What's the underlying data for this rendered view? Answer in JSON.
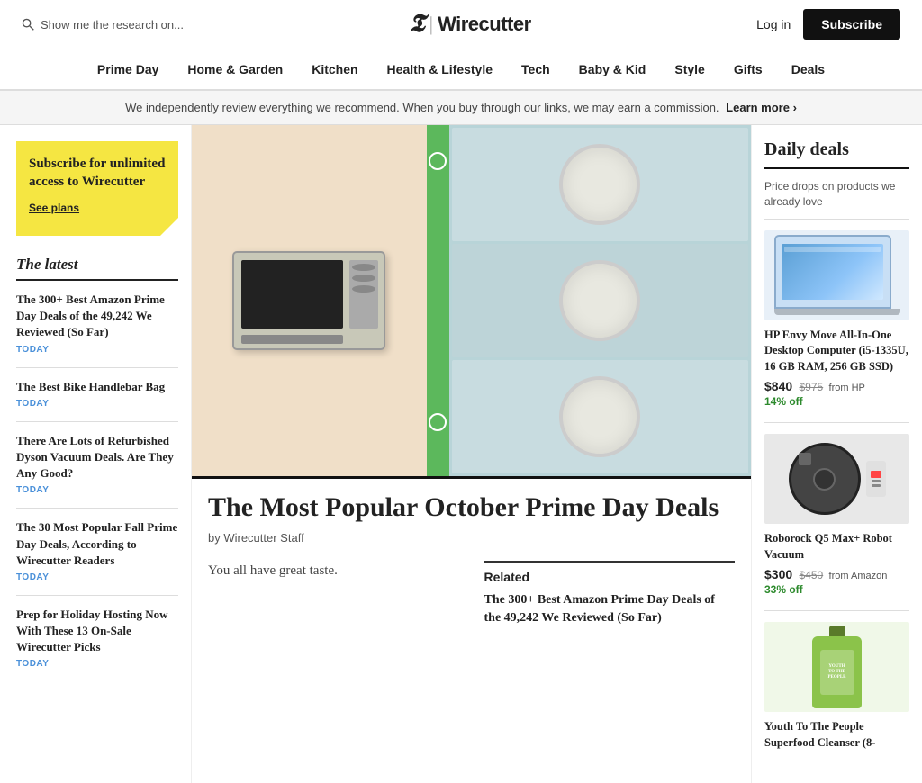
{
  "header": {
    "search_placeholder": "Show me the research on...",
    "logo_t": "T",
    "logo_divider": "|",
    "logo_name": "Wirecutter",
    "login_label": "Log in",
    "subscribe_label": "Subscribe"
  },
  "nav": {
    "items": [
      {
        "id": "prime-day",
        "label": "Prime Day"
      },
      {
        "id": "home-garden",
        "label": "Home & Garden"
      },
      {
        "id": "kitchen",
        "label": "Kitchen"
      },
      {
        "id": "health-lifestyle",
        "label": "Health & Lifestyle"
      },
      {
        "id": "tech",
        "label": "Tech"
      },
      {
        "id": "baby-kid",
        "label": "Baby & Kid"
      },
      {
        "id": "style",
        "label": "Style"
      },
      {
        "id": "gifts",
        "label": "Gifts"
      },
      {
        "id": "deals",
        "label": "Deals"
      }
    ]
  },
  "banner": {
    "text": "We independently review everything we recommend. When you buy through our links, we may earn a commission.",
    "link_text": "Learn more ›"
  },
  "sidebar_left": {
    "subscribe_box": {
      "title": "Subscribe for unlimited access to Wirecutter",
      "link": "See plans"
    },
    "latest_heading": "The latest",
    "items": [
      {
        "title": "The 300+ Best Amazon Prime Day Deals of the 49,242 We Reviewed (So Far)",
        "date": "TODAY"
      },
      {
        "title": "The Best Bike Handlebar Bag",
        "date": "TODAY"
      },
      {
        "title": "There Are Lots of Refurbished Dyson Vacuum Deals. Are They Any Good?",
        "date": "TODAY"
      },
      {
        "title": "The 30 Most Popular Fall Prime Day Deals, According to Wirecutter Readers",
        "date": "TODAY"
      },
      {
        "title": "Prep for Holiday Hosting Now With These 13 On-Sale Wirecutter Picks",
        "date": "TODAY"
      }
    ]
  },
  "hero": {
    "alt": "Prime Day deals hero image showing toaster oven and air purifiers"
  },
  "article": {
    "title": "The Most Popular October Prime Day Deals",
    "byline": "by Wirecutter Staff",
    "description": "You all have great taste.",
    "related_label": "Related",
    "related_items": [
      {
        "title": "The 300+ Best Amazon Prime Day Deals of the 49,242 We Reviewed (So Far)"
      }
    ]
  },
  "daily_deals": {
    "title": "Daily deals",
    "description": "Price drops on products we already love",
    "items": [
      {
        "title": "HP Envy Move All-In-One Desktop Computer (i5-1335U, 16 GB RAM, 256 GB SSD)",
        "current_price": "$840",
        "original_price": "$975",
        "source": "from HP",
        "discount": "14% off",
        "image_type": "laptop"
      },
      {
        "title": "Roborock Q5 Max+ Robot Vacuum",
        "current_price": "$300",
        "original_price": "$450",
        "source": "from Amazon",
        "discount": "33% off",
        "image_type": "vacuum"
      },
      {
        "title": "Youth To The People Superfood Cleanser (8-",
        "current_price": "",
        "original_price": "",
        "source": "",
        "discount": "",
        "image_type": "cleanser"
      }
    ]
  }
}
